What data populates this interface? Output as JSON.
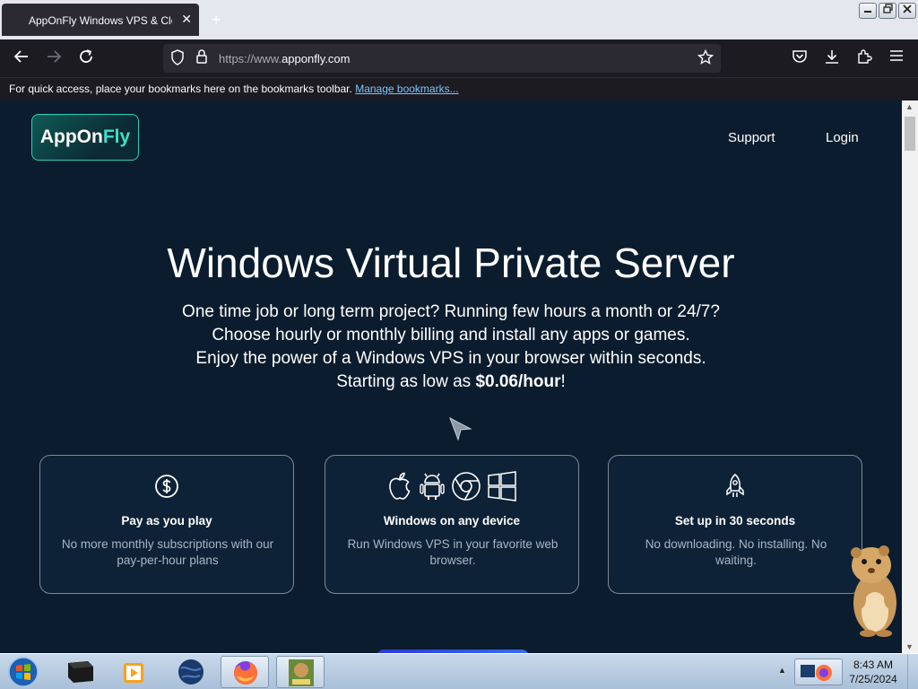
{
  "browser": {
    "tab_title": "AppOnFly Windows VPS & Clo",
    "new_tab_symbol": "+",
    "url_proto": "https://www.",
    "url_host": "apponfly.com",
    "bookmarks_text": "For quick access, place your bookmarks here on the bookmarks toolbar.",
    "bookmarks_link": "Manage bookmarks...",
    "window_buttons": [
      "minimize",
      "restore",
      "close"
    ]
  },
  "site": {
    "logo_app": "AppOn",
    "logo_fly": "Fly",
    "nav": {
      "support": "Support",
      "login": "Login"
    },
    "hero": {
      "title": "Windows Virtual Private Server",
      "line1": "One time job or long term project? Running few hours a month or 24/7?",
      "line2": "Choose hourly or monthly billing and install any apps or games.",
      "line3": "Enjoy the power of a Windows VPS in your browser within seconds.",
      "line4_prefix": "Starting as low as ",
      "line4_price": "$0.06/hour",
      "line4_suffix": "!"
    },
    "cards": [
      {
        "icon": "dollar-icon",
        "title": "Pay as you play",
        "desc": "No more monthly subscriptions with our pay-per-hour plans"
      },
      {
        "icon": "devices-icons",
        "title": "Windows on any device",
        "desc": "Run Windows VPS in your favorite web browser."
      },
      {
        "icon": "rocket-icon",
        "title": "Set up in 30 seconds",
        "desc": "No downloading. No installing. No waiting."
      }
    ]
  },
  "taskbar": {
    "time": "8:43 AM",
    "date": "7/25/2024",
    "apps": [
      "terminal",
      "media-player",
      "globe",
      "firefox",
      "box-game"
    ]
  },
  "colors": {
    "accent": "#3fe0c4",
    "page_bg": "#0b1c2e",
    "card_border": "#7c8a99"
  }
}
